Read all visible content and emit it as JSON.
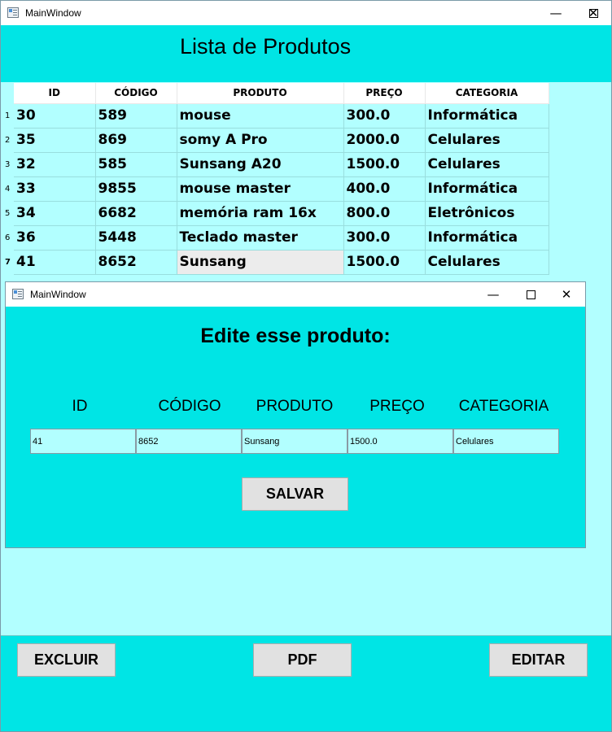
{
  "main_window": {
    "title": "MainWindow",
    "controls": {
      "minimize": "—",
      "maximize": "☐",
      "close": "✕"
    }
  },
  "page_title": "Lista de Produtos",
  "table": {
    "columns": [
      "ID",
      "CÓDIGO",
      "PRODUTO",
      "PREÇO",
      "CATEGORIA"
    ],
    "rows": [
      {
        "num": "1",
        "id": "30",
        "codigo": "589",
        "produto": "mouse",
        "preco": "300.0",
        "categoria": "Informática"
      },
      {
        "num": "2",
        "id": "35",
        "codigo": "869",
        "produto": "somy A Pro",
        "preco": "2000.0",
        "categoria": "Celulares"
      },
      {
        "num": "3",
        "id": "32",
        "codigo": "585",
        "produto": "Sunsang A20",
        "preco": "1500.0",
        "categoria": "Celulares"
      },
      {
        "num": "4",
        "id": "33",
        "codigo": "9855",
        "produto": "mouse master",
        "preco": "400.0",
        "categoria": "Informática"
      },
      {
        "num": "5",
        "id": "34",
        "codigo": "6682",
        "produto": "memória ram 16x",
        "preco": "800.0",
        "categoria": "Eletrônicos"
      },
      {
        "num": "6",
        "id": "36",
        "codigo": "5448",
        "produto": "Teclado master",
        "preco": "300.0",
        "categoria": "Informática"
      },
      {
        "num": "7",
        "id": "41",
        "codigo": "8652",
        "produto": "Sunsang",
        "preco": "1500.0",
        "categoria": "Celulares"
      }
    ]
  },
  "dialog": {
    "title": "MainWindow",
    "controls": {
      "minimize": "—",
      "maximize": "☐",
      "close": "✕"
    },
    "heading": "Edite esse produto:",
    "labels": [
      "ID",
      "CÓDIGO",
      "PRODUTO",
      "PREÇO",
      "CATEGORIA"
    ],
    "values": [
      "41",
      "8652",
      "Sunsang",
      "1500.0",
      "Celulares"
    ],
    "save_label": "SALVAR"
  },
  "footer": {
    "delete_label": "EXCLUIR",
    "pdf_label": "PDF",
    "edit_label": "EDITAR"
  },
  "colors": {
    "accent_cyan": "#00e5e5",
    "light_cyan": "#b2ffff",
    "button_gray": "#e1e1e1"
  }
}
